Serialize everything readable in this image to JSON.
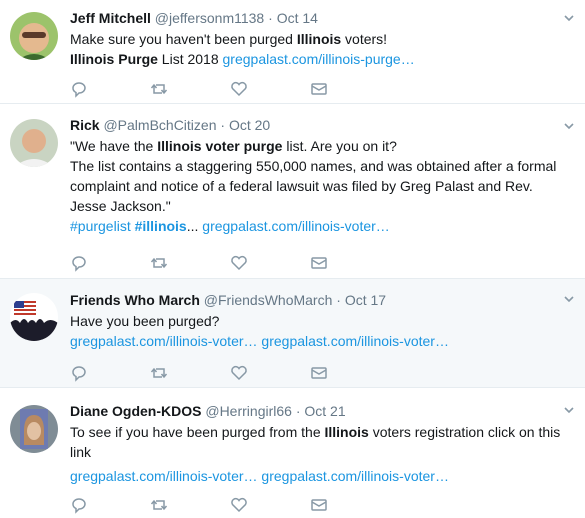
{
  "tweets": [
    {
      "name": "Jeff Mitchell",
      "handle": "@jeffersonm1138",
      "sep": "·",
      "date": "Oct 14",
      "line1_a": "Make sure you haven't been purged ",
      "line1_b": "Illinois",
      "line1_c": " voters!",
      "line2_a": "Illinois Purge",
      "line2_b": " List 2018 ",
      "line2_link": "gregpalast.com/illinois-purge…"
    },
    {
      "name": "Rick",
      "handle": "@PalmBchCitizen",
      "sep": "·",
      "date": "Oct 20",
      "line1_a": "\"We have the ",
      "line1_b": "Illinois voter purge",
      "line1_c": " list. Are you on it?",
      "line2": "The list contains a staggering 550,000 names, and was obtained after a formal",
      "line3": "complaint and notice of a federal lawsuit was filed by Greg Palast and Rev.",
      "line4": "Jesse Jackson.\"",
      "line5_hash1": "#purgelist",
      "line5_hash2": "#illinois",
      "line5_ell": "...",
      "line5_link": "gregpalast.com/illinois-voter…"
    },
    {
      "name": "Friends Who March",
      "handle": "@FriendsWhoMarch",
      "sep": "·",
      "date": "Oct 17",
      "line1": "Have you been purged?",
      "link1": "gregpalast.com/illinois-voter…",
      "link2": "gregpalast.com/illinois-voter…"
    },
    {
      "name": "Diane Ogden-KDOS",
      "handle": "@Herringirl66",
      "sep": "·",
      "date": "Oct 21",
      "line1_a": "To see if you have been purged from the ",
      "line1_b": "Illinois",
      "line1_c": " voters registration click on this",
      "line2": "link",
      "link1": "gregpalast.com/illinois-voter…",
      "link2": "gregpalast.com/illinois-voter…"
    }
  ],
  "icons": {
    "reply": "reply-icon",
    "retweet": "retweet-icon",
    "like": "heart-icon",
    "dm": "envelope-icon",
    "menu": "chevron-down-icon"
  },
  "colors": {
    "link": "#1b95e0",
    "meta": "#657786",
    "text": "#14171a",
    "divider": "#e6ecf0",
    "highlight_bg": "#f5f8fa"
  }
}
